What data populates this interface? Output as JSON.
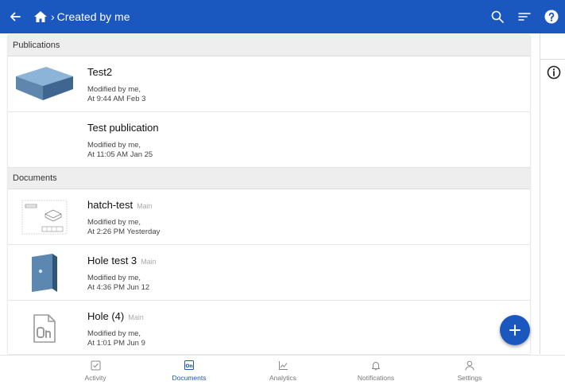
{
  "header": {
    "title": "Created by me",
    "icons": [
      "arrow-back-icon",
      "home-icon",
      "search-icon",
      "sort-icon",
      "help-icon"
    ]
  },
  "publications": {
    "heading": "Publications",
    "items": [
      {
        "name": "Test2",
        "modified_by": "Modified by me,",
        "modified_at": "At 9:44 AM Feb 3"
      },
      {
        "name": "Test publication",
        "modified_by": "Modified by me,",
        "modified_at": "At 11:05 AM Jan 25"
      }
    ]
  },
  "documents": {
    "heading": "Documents",
    "items": [
      {
        "name": "hatch-test",
        "branch": "Main",
        "modified_by": "Modified by me,",
        "modified_at": "At 2:26 PM Yesterday"
      },
      {
        "name": "Hole test 3",
        "branch": "Main",
        "modified_by": "Modified by me,",
        "modified_at": "At 4:36 PM Jun 12"
      },
      {
        "name": "Hole (4)",
        "branch": "Main",
        "modified_by": "Modified by me,",
        "modified_at": "At 1:01 PM Jun 9"
      }
    ]
  },
  "bottom_nav": {
    "items": [
      {
        "label": "Activity",
        "icon": "activity-icon",
        "active": false
      },
      {
        "label": "Documents",
        "icon": "documents-icon",
        "active": true
      },
      {
        "label": "Analytics",
        "icon": "analytics-icon",
        "active": false
      },
      {
        "label": "Notifications",
        "icon": "bell-icon",
        "active": false
      },
      {
        "label": "Settings",
        "icon": "user-icon",
        "active": false
      }
    ]
  },
  "colors": {
    "accent": "#1a57be",
    "section_bg": "#eeeeee",
    "border": "#e4e4e4"
  }
}
